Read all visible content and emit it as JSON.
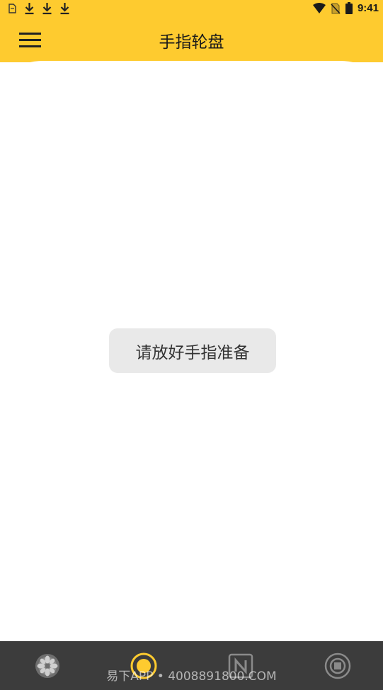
{
  "status_bar": {
    "time": "9:41",
    "left_icons": [
      "sim-card-icon",
      "download-icon",
      "download-icon",
      "download-icon"
    ],
    "right_icons": [
      "wifi-icon",
      "no-sim-icon",
      "battery-icon"
    ]
  },
  "app_bar": {
    "title": "手指轮盘",
    "menu_icon": "menu-icon",
    "background_color": "#fecb2f"
  },
  "main": {
    "toast_text": "请放好手指准备"
  },
  "bottom_nav": {
    "items": [
      {
        "icon": "wheel-icon",
        "selected": false
      },
      {
        "icon": "target-icon",
        "selected": true
      },
      {
        "icon": "n-box-icon",
        "selected": false
      },
      {
        "icon": "stop-icon",
        "selected": false
      }
    ],
    "watermark": "易下APP • 4008891800.COM",
    "accent_color": "#fecb2f",
    "background_color": "#3c3c3c"
  }
}
